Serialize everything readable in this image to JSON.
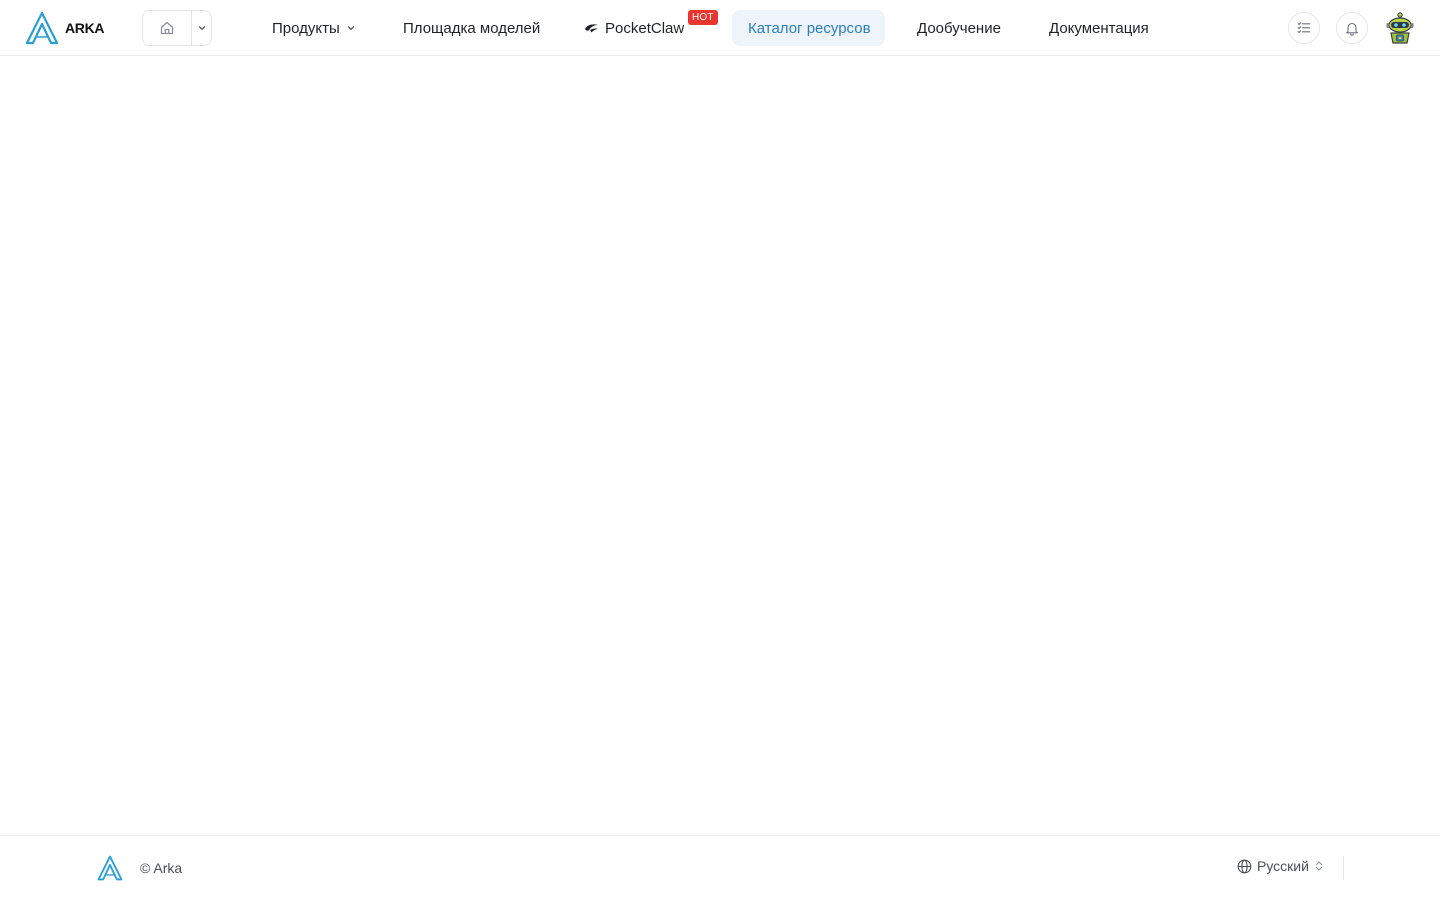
{
  "brand": {
    "name": "ARKA",
    "accent": "#2a9fd6"
  },
  "nav": {
    "items": [
      {
        "label": "Продукты",
        "has_dropdown": true
      },
      {
        "label": "Площадка моделей"
      },
      {
        "label": "PocketClaw",
        "badge": "HOT"
      },
      {
        "label": "Каталог ресурсов",
        "active": true
      },
      {
        "label": "Дообучение"
      },
      {
        "label": "Документация"
      }
    ]
  },
  "header_icons": {
    "home": "home-icon",
    "tasks": "task-list-icon",
    "notifications": "bell-icon",
    "avatar": "robot-avatar"
  },
  "footer": {
    "copyright": "© Arka",
    "language": "Русский"
  },
  "colors": {
    "active_bg": "#eef4fa",
    "active_text": "#2a7fc1",
    "hot_badge": "#e8362f"
  }
}
